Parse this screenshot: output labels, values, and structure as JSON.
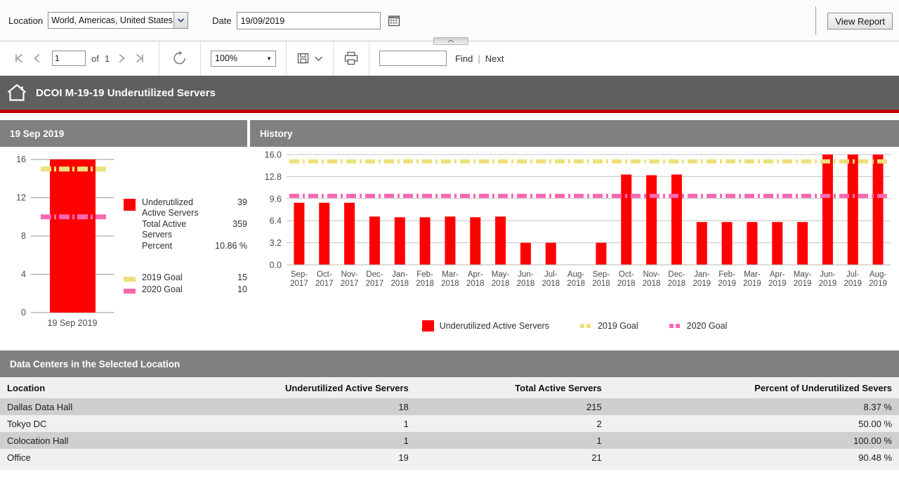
{
  "params": {
    "location_label": "Location",
    "location_value": "World, Americas, United States, C",
    "date_label": "Date",
    "date_value": "19/09/2019",
    "calendar_icon": "calendar-icon",
    "view_report_label": "View Report",
    "splitter_icon": "splitter-grip-icon"
  },
  "toolbar": {
    "first_page_icon": "first-page-icon",
    "prev_page_icon": "previous-page-icon",
    "page_number": "1",
    "of_label": "of",
    "page_total": "1",
    "next_page_icon": "next-page-icon",
    "last_page_icon": "last-page-icon",
    "refresh_icon": "refresh-icon",
    "zoom_value": "100%",
    "zoom_caret": "chevron-down-icon",
    "export_icon": "save-export-icon",
    "export_caret": "chevron-down-icon",
    "print_icon": "print-icon",
    "find_value": "",
    "find_label": "Find",
    "find_separator": "|",
    "next_label": "Next"
  },
  "report": {
    "home_icon": "home-icon",
    "title": "DCOI M-19-19 Underutilized Servers",
    "accent_color": "#c00000"
  },
  "left_panel": {
    "header": "19 Sep 2019",
    "legend": [
      {
        "icon": "red-square-swatch",
        "name": "Underutilized Active Servers",
        "value": "39",
        "color": "#ff0000"
      },
      {
        "icon": "",
        "name": "Total Active Servers",
        "value": "359",
        "color": ""
      },
      {
        "icon": "",
        "name": "Percent",
        "value": "10.86 %",
        "color": ""
      }
    ],
    "goals": [
      {
        "icon": "yellow-dash-swatch",
        "name": "2019 Goal",
        "value": "15",
        "color": "#ece07a"
      },
      {
        "icon": "pink-dash-swatch",
        "name": "2020 Goal",
        "value": "10",
        "color": "#f768b0"
      }
    ]
  },
  "right_panel": {
    "header": "History",
    "legend": [
      {
        "icon": "red-square-swatch",
        "label": "Underutilized Active Servers",
        "color": "#ff0000",
        "style": "box"
      },
      {
        "icon": "yellow-dash-swatch",
        "label": "2019 Goal",
        "color": "#ece07a",
        "style": "dash"
      },
      {
        "icon": "pink-dash-swatch",
        "label": "2020 Goal",
        "color": "#f768b0",
        "style": "dash"
      }
    ]
  },
  "table": {
    "header": "Data Centers in the Selected Location",
    "columns": [
      "Location",
      "Underutilized Active Servers",
      "Total Active Servers",
      "Percent of Underutilized Severs"
    ],
    "rows": [
      {
        "location": "Dallas Data Hall",
        "underutilized": "18",
        "total": "215",
        "percent": "8.37 %"
      },
      {
        "location": "Tokyo DC",
        "underutilized": "1",
        "total": "2",
        "percent": "50.00 %"
      },
      {
        "location": "Colocation Hall",
        "underutilized": "1",
        "total": "1",
        "percent": "100.00 %"
      },
      {
        "location": "Office",
        "underutilized": "19",
        "total": "21",
        "percent": "90.48 %"
      }
    ]
  },
  "chart_data": [
    {
      "type": "bar",
      "title": "19 Sep 2019",
      "categories": [
        "19 Sep 2019"
      ],
      "series": [
        {
          "name": "Underutilized Active Servers",
          "values": [
            16
          ],
          "color": "#ff0000"
        }
      ],
      "reference_lines": [
        {
          "name": "2019 Goal",
          "value": 15,
          "color": "#ece07a",
          "style": "dash-dot"
        },
        {
          "name": "2020 Goal",
          "value": 10,
          "color": "#f768b0",
          "style": "dash-dot"
        }
      ],
      "xlabel": "",
      "ylabel": "",
      "ylim": [
        0,
        16
      ],
      "yticks": [
        0,
        4,
        8,
        12,
        16
      ],
      "grid": true,
      "legend_position": "right"
    },
    {
      "type": "bar",
      "title": "History",
      "categories": [
        "Sep-2017",
        "Oct-2017",
        "Nov-2017",
        "Dec-2017",
        "Jan-2018",
        "Feb-2018",
        "Mar-2018",
        "Apr-2018",
        "May-2018",
        "Jun-2018",
        "Jul-2018",
        "Aug-2018",
        "Sep-2018",
        "Oct-2018",
        "Nov-2018",
        "Dec-2018",
        "Jan-2019",
        "Feb-2019",
        "Mar-2019",
        "Apr-2019",
        "May-2019",
        "Jun-2019",
        "Jul-2019",
        "Aug-2019"
      ],
      "series": [
        {
          "name": "Underutilized Active Servers",
          "color": "#ff0000",
          "values": [
            9.0,
            9.0,
            9.0,
            7.0,
            6.9,
            6.9,
            7.0,
            6.9,
            7.0,
            3.2,
            3.2,
            0,
            3.2,
            13.1,
            13.0,
            13.1,
            6.2,
            6.2,
            6.2,
            6.2,
            6.2,
            16.0,
            16.0,
            16.0
          ]
        }
      ],
      "reference_lines": [
        {
          "name": "2019 Goal",
          "value": 15,
          "color": "#ece07a",
          "style": "dash-dot"
        },
        {
          "name": "2020 Goal",
          "value": 10,
          "color": "#f768b0",
          "style": "dash-dot"
        }
      ],
      "xlabel": "",
      "ylabel": "",
      "ylim": [
        0,
        16
      ],
      "yticks": [
        0.0,
        3.2,
        6.4,
        9.6,
        12.8,
        16.0
      ],
      "ytick_labels": [
        "0.0",
        "3.2",
        "6.4",
        "9.6",
        "12.8",
        "16.0"
      ],
      "grid": true,
      "legend_position": "bottom"
    }
  ]
}
